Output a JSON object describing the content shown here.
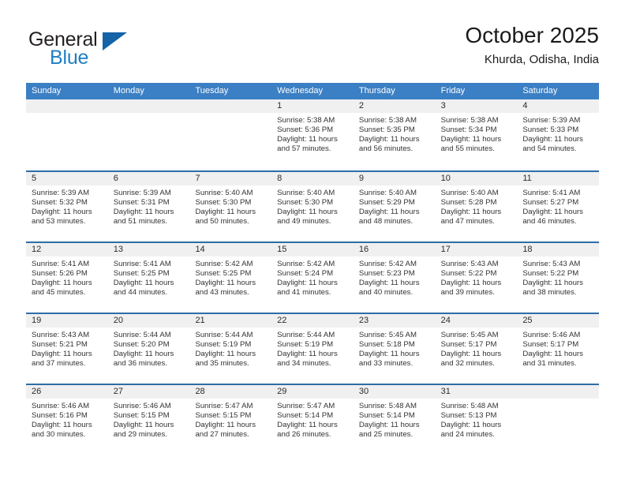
{
  "brand": {
    "name_top": "General",
    "name_bottom": "Blue",
    "triangle_color": "#1463a8",
    "blue_color": "#1f7ec4"
  },
  "header": {
    "title": "October 2025",
    "subtitle": "Khurda, Odisha, India"
  },
  "theme": {
    "header_bg": "#3b7fc4",
    "row_divider": "#2e6da8",
    "day_strip_bg": "#f0f0f0"
  },
  "weekdays": [
    "Sunday",
    "Monday",
    "Tuesday",
    "Wednesday",
    "Thursday",
    "Friday",
    "Saturday"
  ],
  "weeks": [
    [
      {
        "day": "",
        "sunrise": "",
        "sunset": "",
        "daylight_line1": "",
        "daylight_line2": ""
      },
      {
        "day": "",
        "sunrise": "",
        "sunset": "",
        "daylight_line1": "",
        "daylight_line2": ""
      },
      {
        "day": "",
        "sunrise": "",
        "sunset": "",
        "daylight_line1": "",
        "daylight_line2": ""
      },
      {
        "day": "1",
        "sunrise": "Sunrise: 5:38 AM",
        "sunset": "Sunset: 5:36 PM",
        "daylight_line1": "Daylight: 11 hours",
        "daylight_line2": "and 57 minutes."
      },
      {
        "day": "2",
        "sunrise": "Sunrise: 5:38 AM",
        "sunset": "Sunset: 5:35 PM",
        "daylight_line1": "Daylight: 11 hours",
        "daylight_line2": "and 56 minutes."
      },
      {
        "day": "3",
        "sunrise": "Sunrise: 5:38 AM",
        "sunset": "Sunset: 5:34 PM",
        "daylight_line1": "Daylight: 11 hours",
        "daylight_line2": "and 55 minutes."
      },
      {
        "day": "4",
        "sunrise": "Sunrise: 5:39 AM",
        "sunset": "Sunset: 5:33 PM",
        "daylight_line1": "Daylight: 11 hours",
        "daylight_line2": "and 54 minutes."
      }
    ],
    [
      {
        "day": "5",
        "sunrise": "Sunrise: 5:39 AM",
        "sunset": "Sunset: 5:32 PM",
        "daylight_line1": "Daylight: 11 hours",
        "daylight_line2": "and 53 minutes."
      },
      {
        "day": "6",
        "sunrise": "Sunrise: 5:39 AM",
        "sunset": "Sunset: 5:31 PM",
        "daylight_line1": "Daylight: 11 hours",
        "daylight_line2": "and 51 minutes."
      },
      {
        "day": "7",
        "sunrise": "Sunrise: 5:40 AM",
        "sunset": "Sunset: 5:30 PM",
        "daylight_line1": "Daylight: 11 hours",
        "daylight_line2": "and 50 minutes."
      },
      {
        "day": "8",
        "sunrise": "Sunrise: 5:40 AM",
        "sunset": "Sunset: 5:30 PM",
        "daylight_line1": "Daylight: 11 hours",
        "daylight_line2": "and 49 minutes."
      },
      {
        "day": "9",
        "sunrise": "Sunrise: 5:40 AM",
        "sunset": "Sunset: 5:29 PM",
        "daylight_line1": "Daylight: 11 hours",
        "daylight_line2": "and 48 minutes."
      },
      {
        "day": "10",
        "sunrise": "Sunrise: 5:40 AM",
        "sunset": "Sunset: 5:28 PM",
        "daylight_line1": "Daylight: 11 hours",
        "daylight_line2": "and 47 minutes."
      },
      {
        "day": "11",
        "sunrise": "Sunrise: 5:41 AM",
        "sunset": "Sunset: 5:27 PM",
        "daylight_line1": "Daylight: 11 hours",
        "daylight_line2": "and 46 minutes."
      }
    ],
    [
      {
        "day": "12",
        "sunrise": "Sunrise: 5:41 AM",
        "sunset": "Sunset: 5:26 PM",
        "daylight_line1": "Daylight: 11 hours",
        "daylight_line2": "and 45 minutes."
      },
      {
        "day": "13",
        "sunrise": "Sunrise: 5:41 AM",
        "sunset": "Sunset: 5:25 PM",
        "daylight_line1": "Daylight: 11 hours",
        "daylight_line2": "and 44 minutes."
      },
      {
        "day": "14",
        "sunrise": "Sunrise: 5:42 AM",
        "sunset": "Sunset: 5:25 PM",
        "daylight_line1": "Daylight: 11 hours",
        "daylight_line2": "and 43 minutes."
      },
      {
        "day": "15",
        "sunrise": "Sunrise: 5:42 AM",
        "sunset": "Sunset: 5:24 PM",
        "daylight_line1": "Daylight: 11 hours",
        "daylight_line2": "and 41 minutes."
      },
      {
        "day": "16",
        "sunrise": "Sunrise: 5:42 AM",
        "sunset": "Sunset: 5:23 PM",
        "daylight_line1": "Daylight: 11 hours",
        "daylight_line2": "and 40 minutes."
      },
      {
        "day": "17",
        "sunrise": "Sunrise: 5:43 AM",
        "sunset": "Sunset: 5:22 PM",
        "daylight_line1": "Daylight: 11 hours",
        "daylight_line2": "and 39 minutes."
      },
      {
        "day": "18",
        "sunrise": "Sunrise: 5:43 AM",
        "sunset": "Sunset: 5:22 PM",
        "daylight_line1": "Daylight: 11 hours",
        "daylight_line2": "and 38 minutes."
      }
    ],
    [
      {
        "day": "19",
        "sunrise": "Sunrise: 5:43 AM",
        "sunset": "Sunset: 5:21 PM",
        "daylight_line1": "Daylight: 11 hours",
        "daylight_line2": "and 37 minutes."
      },
      {
        "day": "20",
        "sunrise": "Sunrise: 5:44 AM",
        "sunset": "Sunset: 5:20 PM",
        "daylight_line1": "Daylight: 11 hours",
        "daylight_line2": "and 36 minutes."
      },
      {
        "day": "21",
        "sunrise": "Sunrise: 5:44 AM",
        "sunset": "Sunset: 5:19 PM",
        "daylight_line1": "Daylight: 11 hours",
        "daylight_line2": "and 35 minutes."
      },
      {
        "day": "22",
        "sunrise": "Sunrise: 5:44 AM",
        "sunset": "Sunset: 5:19 PM",
        "daylight_line1": "Daylight: 11 hours",
        "daylight_line2": "and 34 minutes."
      },
      {
        "day": "23",
        "sunrise": "Sunrise: 5:45 AM",
        "sunset": "Sunset: 5:18 PM",
        "daylight_line1": "Daylight: 11 hours",
        "daylight_line2": "and 33 minutes."
      },
      {
        "day": "24",
        "sunrise": "Sunrise: 5:45 AM",
        "sunset": "Sunset: 5:17 PM",
        "daylight_line1": "Daylight: 11 hours",
        "daylight_line2": "and 32 minutes."
      },
      {
        "day": "25",
        "sunrise": "Sunrise: 5:46 AM",
        "sunset": "Sunset: 5:17 PM",
        "daylight_line1": "Daylight: 11 hours",
        "daylight_line2": "and 31 minutes."
      }
    ],
    [
      {
        "day": "26",
        "sunrise": "Sunrise: 5:46 AM",
        "sunset": "Sunset: 5:16 PM",
        "daylight_line1": "Daylight: 11 hours",
        "daylight_line2": "and 30 minutes."
      },
      {
        "day": "27",
        "sunrise": "Sunrise: 5:46 AM",
        "sunset": "Sunset: 5:15 PM",
        "daylight_line1": "Daylight: 11 hours",
        "daylight_line2": "and 29 minutes."
      },
      {
        "day": "28",
        "sunrise": "Sunrise: 5:47 AM",
        "sunset": "Sunset: 5:15 PM",
        "daylight_line1": "Daylight: 11 hours",
        "daylight_line2": "and 27 minutes."
      },
      {
        "day": "29",
        "sunrise": "Sunrise: 5:47 AM",
        "sunset": "Sunset: 5:14 PM",
        "daylight_line1": "Daylight: 11 hours",
        "daylight_line2": "and 26 minutes."
      },
      {
        "day": "30",
        "sunrise": "Sunrise: 5:48 AM",
        "sunset": "Sunset: 5:14 PM",
        "daylight_line1": "Daylight: 11 hours",
        "daylight_line2": "and 25 minutes."
      },
      {
        "day": "31",
        "sunrise": "Sunrise: 5:48 AM",
        "sunset": "Sunset: 5:13 PM",
        "daylight_line1": "Daylight: 11 hours",
        "daylight_line2": "and 24 minutes."
      },
      {
        "day": "",
        "sunrise": "",
        "sunset": "",
        "daylight_line1": "",
        "daylight_line2": ""
      }
    ]
  ]
}
